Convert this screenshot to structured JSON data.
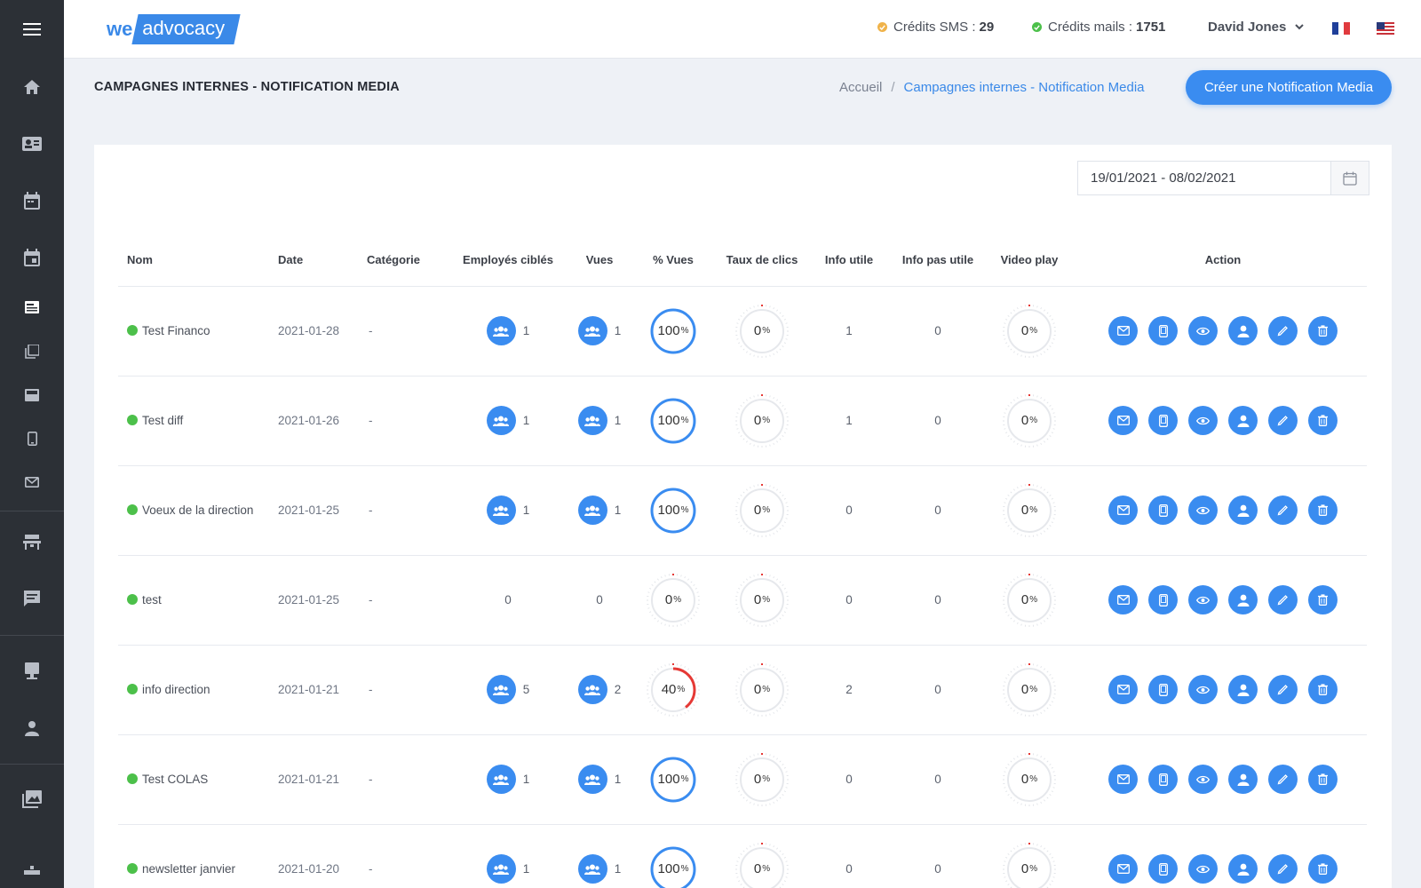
{
  "app": {
    "logo_we": "we",
    "logo_advocacy": "advocacy"
  },
  "topbar": {
    "sms_label": "Crédits SMS :",
    "sms_value": "29",
    "mail_label": "Crédits mails :",
    "mail_value": "1751",
    "user_name": "David Jones",
    "colors": {
      "sms_dot": "#f0b34a",
      "mail_dot": "#4cc04a"
    }
  },
  "sidebar": {
    "items": [
      {
        "icon": "home-icon"
      },
      {
        "icon": "contact-card-icon"
      },
      {
        "icon": "calendar-icon"
      },
      {
        "icon": "calendar-event-icon"
      },
      {
        "icon": "news-icon"
      },
      {
        "icon": "documents-icon"
      },
      {
        "icon": "media-icon"
      },
      {
        "icon": "mobile-icon"
      },
      {
        "icon": "mail-icon"
      },
      {
        "icon": "workstation-icon"
      },
      {
        "icon": "chat-icon"
      },
      {
        "icon": "desktop-icon"
      },
      {
        "icon": "user-icon"
      },
      {
        "icon": "gallery-icon"
      }
    ]
  },
  "page": {
    "title": "CAMPAGNES INTERNES - NOTIFICATION MEDIA",
    "breadcrumb_home": "Accueil",
    "breadcrumb_sep": "/",
    "breadcrumb_current": "Campagnes internes - Notification Media",
    "create_button": "Créer une Notification Media",
    "date_range": "19/01/2021 - 08/02/2021"
  },
  "table": {
    "headers": {
      "nom": "Nom",
      "date": "Date",
      "categorie": "Catégorie",
      "employes": "Employés ciblés",
      "vues": "Vues",
      "pct_vues": "% Vues",
      "taux_clics": "Taux de clics",
      "info_utile": "Info utile",
      "info_pas_utile": "Info pas utile",
      "video_play": "Video play",
      "action": "Action"
    },
    "percent_sign": "%",
    "rows": [
      {
        "name": "Test Financo",
        "date": "2021-01-28",
        "category": "-",
        "employees": "1",
        "views": "1",
        "pct_views": 100,
        "click_rate": 0,
        "useful": "1",
        "not_useful": "0",
        "video_play": 0
      },
      {
        "name": "Test diff",
        "date": "2021-01-26",
        "category": "-",
        "employees": "1",
        "views": "1",
        "pct_views": 100,
        "click_rate": 0,
        "useful": "1",
        "not_useful": "0",
        "video_play": 0
      },
      {
        "name": "Voeux de la direction",
        "date": "2021-01-25",
        "category": "-",
        "employees": "1",
        "views": "1",
        "pct_views": 100,
        "click_rate": 0,
        "useful": "0",
        "not_useful": "0",
        "video_play": 0
      },
      {
        "name": "test",
        "date": "2021-01-25",
        "category": "-",
        "employees": "0",
        "views": "0",
        "pct_views": 0,
        "click_rate": 0,
        "useful": "0",
        "not_useful": "0",
        "video_play": 0
      },
      {
        "name": "info direction",
        "date": "2021-01-21",
        "category": "-",
        "employees": "5",
        "views": "2",
        "pct_views": 40,
        "click_rate": 0,
        "useful": "2",
        "not_useful": "0",
        "video_play": 0
      },
      {
        "name": "Test COLAS",
        "date": "2021-01-21",
        "category": "-",
        "employees": "1",
        "views": "1",
        "pct_views": 100,
        "click_rate": 0,
        "useful": "0",
        "not_useful": "0",
        "video_play": 0
      },
      {
        "name": "newsletter janvier",
        "date": "2021-01-20",
        "category": "-",
        "employees": "1",
        "views": "1",
        "pct_views": 100,
        "click_rate": 0,
        "useful": "0",
        "not_useful": "0",
        "video_play": 0
      }
    ],
    "action_icons": [
      "mail-icon",
      "mobile-icon",
      "eye-icon",
      "user-icon",
      "pencil-icon",
      "trash-icon"
    ]
  },
  "colors": {
    "accent": "#3a8cf0",
    "gauge_full": "#3a8cf0",
    "gauge_partial": "#e53935",
    "gauge_track": "#e6e8ec",
    "status_active": "#4cc04a",
    "sidebar_bg": "#2c3036"
  }
}
